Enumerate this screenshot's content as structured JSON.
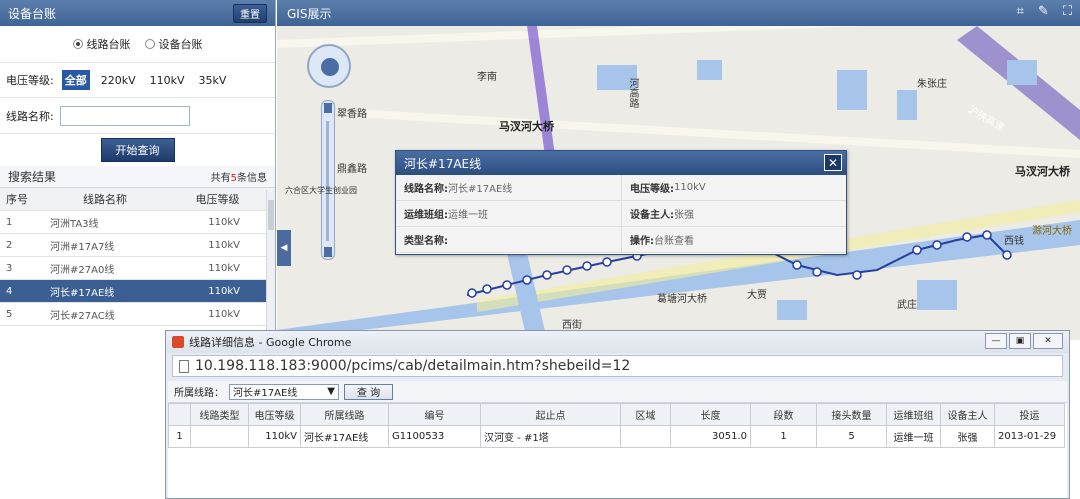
{
  "left_panel": {
    "title": "设备台账",
    "reset_label": "重置",
    "radio_line": "线路台账",
    "radio_device": "设备台账",
    "voltage_label": "电压等级:",
    "voltage_options": [
      "全部",
      "220kV",
      "110kV",
      "35kV"
    ],
    "line_name_label": "线路名称:",
    "query_label": "开始查询",
    "results_title": "搜索结果",
    "results_count_prefix": "共有",
    "results_count": "5",
    "results_count_suffix": "条信息",
    "columns": [
      "序号",
      "线路名称",
      "电压等级"
    ],
    "rows": [
      {
        "no": "1",
        "name": "河洲TA3线",
        "voltage": "110kV"
      },
      {
        "no": "2",
        "name": "河洲#17A7线",
        "voltage": "110kV"
      },
      {
        "no": "3",
        "name": "河洲#27A0线",
        "voltage": "110kV"
      },
      {
        "no": "4",
        "name": "河长#17AE线",
        "voltage": "110kV"
      },
      {
        "no": "5",
        "name": "河长#27AC线",
        "voltage": "110kV"
      }
    ]
  },
  "map": {
    "title": "GIS展示",
    "labels": [
      "翠香路",
      "李南",
      "河高路",
      "马汊河大桥",
      "鼎鑫路",
      "六合区大学生创业园",
      "马汊河大桥",
      "葛塘河大桥",
      "西街",
      "大贾",
      "武庄",
      "西钱",
      "朱张庄",
      "滁河大桥",
      "沪陕高速"
    ],
    "popup": {
      "title": "河长#17AE线",
      "line_name_label": "线路名称:",
      "line_name": "河长#17AE线",
      "voltage_label": "电压等级:",
      "voltage": "110kV",
      "team_label": "运维班组:",
      "team": "运维一班",
      "owner_label": "设备主人:",
      "owner": "张强",
      "type_label": "类型名称:",
      "type": "",
      "action_label": "操作:",
      "action": "台账查看"
    }
  },
  "browser": {
    "window_title": "线路详细信息 - Google Chrome",
    "url": "10.198.118.183:9000/pcims/cab/detailmain.htm?shebeiId=12",
    "filter_label": "所属线路：",
    "filter_value": "河长#17AE线",
    "query_label": "查 询",
    "columns": [
      "",
      "线路类型",
      "电压等级",
      "所属线路",
      "编号",
      "起止点",
      "区域",
      "长度",
      "段数",
      "接头数量",
      "运维班组",
      "设备主人",
      "投运"
    ],
    "rows": [
      {
        "no": "1",
        "type": "",
        "voltage": "110kV",
        "line": "河长#17AE线",
        "code": "G1100533",
        "endpoints": "汉河变 - #1塔",
        "region": "",
        "length": "3051.0",
        "segments": "1",
        "joints": "5",
        "team": "运维一班",
        "owner": "张强",
        "date": "2013-01-29"
      }
    ]
  },
  "colors": {
    "header": "#4a6ea3",
    "selected_row": "#3c5f93",
    "route": "#2540a0",
    "count": "#e0201a"
  }
}
